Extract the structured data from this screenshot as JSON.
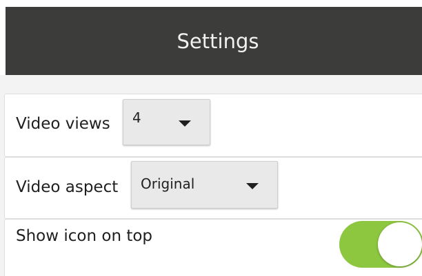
{
  "header": {
    "title": "Settings"
  },
  "settings": {
    "video_views": {
      "label": "Video views",
      "value": "4"
    },
    "video_aspect": {
      "label": "Video aspect",
      "value": "Original"
    },
    "show_icon_on_top": {
      "label": "Show icon on top",
      "enabled": true
    }
  },
  "colors": {
    "title_bar": "#3c3d3b",
    "toggle_on": "#8dc63f",
    "background": "#f3f3f3"
  },
  "icons": {
    "dropdown": "caret-down-icon",
    "toggle": "toggle-switch"
  }
}
